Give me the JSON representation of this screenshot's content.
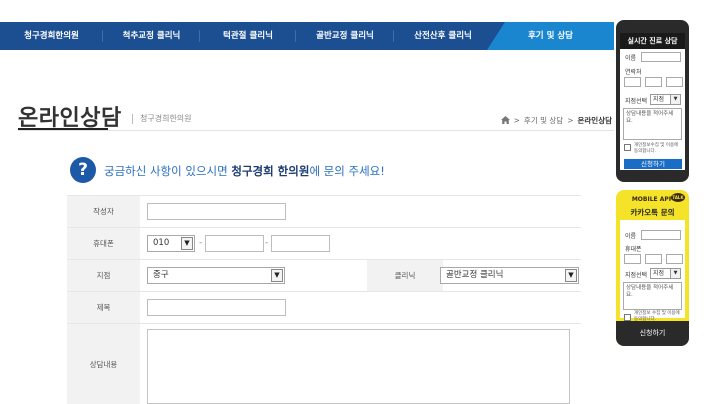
{
  "nav": {
    "items": [
      "청구경희한의원",
      "척추교정 클리닉",
      "턱관절 클리닉",
      "골반교정 클리닉",
      "산전산후 클리닉",
      "후기 및 상담"
    ]
  },
  "page": {
    "title": "온라인상담",
    "subtitle": "청구경희한의원",
    "breadcrumb": [
      "후기 및 상담",
      "온라인상담"
    ]
  },
  "banner": {
    "icon": "?",
    "prefix": "궁금하신 사항이 있으시면 ",
    "strong": "청구경희 한의원",
    "suffix": "에 문의 주세요!"
  },
  "form": {
    "author_label": "작성자",
    "phone_label": "휴대폰",
    "phone_prefix": "010",
    "branch_label": "지점",
    "branch_value": "중구",
    "clinic_label": "클리닉",
    "clinic_value": "골반교정 클리닉",
    "subject_label": "제목",
    "content_label": "상담내용",
    "dash": "-"
  },
  "widget_live": {
    "title": "실시간 진료 상담",
    "name_label": "이름",
    "phone_label": "연락처",
    "branch_label": "지점선택",
    "branch_value": "지점",
    "content_placeholder": "상담내용을 적어주세요.",
    "agree": "개인정보수집 및 이용에 동의합니다.",
    "submit": "신청하기"
  },
  "widget_kakao": {
    "top": "MOBILE APP",
    "talk": "TALK",
    "title": "카카오톡 문의",
    "name_label": "이름",
    "phone_label": "휴대폰",
    "branch_label": "지점선택",
    "branch_value": "지점",
    "content_placeholder": "상담내용을 적어주세요.",
    "agree": "개인정보 수집 및 이용에 동의합니다.",
    "submit": "신청하기"
  },
  "colors": {
    "nav": "#1c4f92",
    "nav_active": "#1a86d0",
    "kakao": "#f5e32a"
  }
}
